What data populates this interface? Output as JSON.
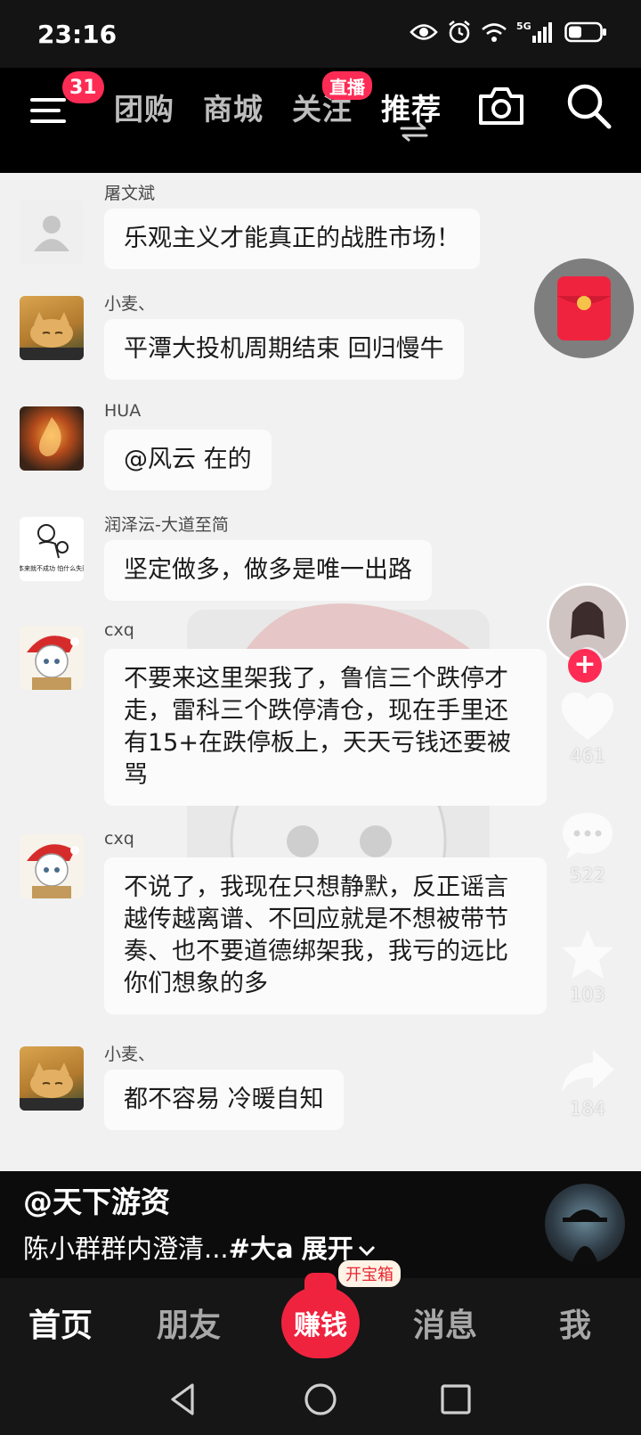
{
  "status_bar": {
    "time": "23:16",
    "network": "5G"
  },
  "top_nav": {
    "menu_badge": "31",
    "tabs": [
      {
        "label": "团购"
      },
      {
        "label": "商城"
      },
      {
        "label": "关注"
      },
      {
        "label": "推荐"
      }
    ],
    "live_badge": "直播",
    "active_tab": "推荐"
  },
  "comments": [
    {
      "user": "屠文斌",
      "text": "乐观主义才能真正的战胜市场！"
    },
    {
      "user": "小麦、",
      "text": "平潭大投机周期结束 回归慢牛"
    },
    {
      "user": "HUA",
      "text": "@风云 在的"
    },
    {
      "user": "润泽沄-大道至简",
      "text": "坚定做多，做多是唯一出路",
      "avatar_text": "你本来就不成功 怕什么失败?"
    },
    {
      "user": "cxq",
      "text": "不要来这里架我了，鲁信三个跌停才走，雷科三个跌停清仓，现在手里还有15+在跌停板上，天天亏钱还要被骂"
    },
    {
      "user": "cxq",
      "text": "不说了，我现在只想静默，反正谣言越传越离谱、不回应就是不想被带节奏、也不要道德绑架我，我亏的远比你们想象的多"
    },
    {
      "user": "小麦、",
      "text": "都不容易 冷暖自知"
    }
  ],
  "actions": {
    "likes": "461",
    "comments": "522",
    "favorites": "103",
    "shares": "184"
  },
  "caption": {
    "author": "@天下游资",
    "description": "陈小群群内澄清...",
    "hashtag": "#大a",
    "expand": "展开"
  },
  "bottom_nav": {
    "home": "首页",
    "friends": "朋友",
    "earn": "赚钱",
    "treasure": "开宝箱",
    "messages": "消息",
    "me": "我"
  },
  "colors": {
    "accent": "#fe2c55",
    "earn": "#f0233f",
    "bubble": "#fbfbfb",
    "video_bg": "#f1f1f1"
  }
}
